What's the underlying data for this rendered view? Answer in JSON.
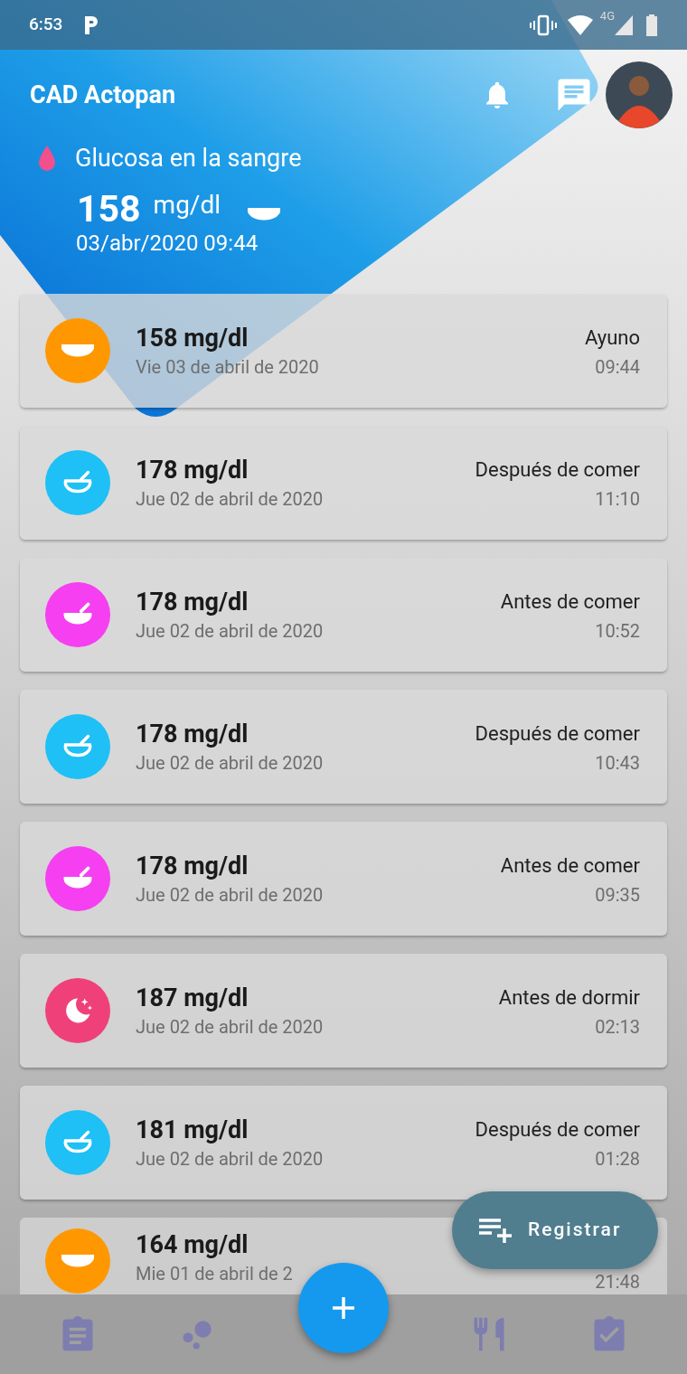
{
  "status_bar": {
    "time": "6:53",
    "network": "4G"
  },
  "header": {
    "title": "CAD Actopan",
    "metric": "Glucosa en la sangre",
    "value": "158",
    "unit": "mg/dl",
    "kind": "fasting",
    "timestamp": "03/abr/2020 09:44"
  },
  "readings": [
    {
      "value": "158 mg/dl",
      "date": "Vie 03 de abril de 2020",
      "label": "Ayuno",
      "time": "09:44",
      "kind": "fasting",
      "color": "#ff9800"
    },
    {
      "value": "178 mg/dl",
      "date": "Jue 02 de abril de 2020",
      "label": "Después de comer",
      "time": "11:10",
      "kind": "after_meal",
      "color": "#1ec0f5"
    },
    {
      "value": "178 mg/dl",
      "date": "Jue 02 de abril de 2020",
      "label": "Antes de comer",
      "time": "10:52",
      "kind": "before_meal",
      "color": "#f53ff0"
    },
    {
      "value": "178 mg/dl",
      "date": "Jue 02 de abril de 2020",
      "label": "Después de comer",
      "time": "10:43",
      "kind": "after_meal",
      "color": "#1ec0f5"
    },
    {
      "value": "178 mg/dl",
      "date": "Jue 02 de abril de 2020",
      "label": "Antes de comer",
      "time": "09:35",
      "kind": "before_meal",
      "color": "#f53ff0"
    },
    {
      "value": "187 mg/dl",
      "date": "Jue 02 de abril de 2020",
      "label": "Antes de dormir",
      "time": "02:13",
      "kind": "bedtime",
      "color": "#f0407a"
    },
    {
      "value": "181 mg/dl",
      "date": "Jue 02 de abril de 2020",
      "label": "Después de comer",
      "time": "01:28",
      "kind": "after_meal",
      "color": "#1ec0f5"
    },
    {
      "value": "164 mg/dl",
      "date": "Mie 01 de abril de 2",
      "time": "21:48",
      "kind": "fasting",
      "color": "#ff9800"
    }
  ],
  "speed_dial": {
    "label": "Registrar"
  }
}
